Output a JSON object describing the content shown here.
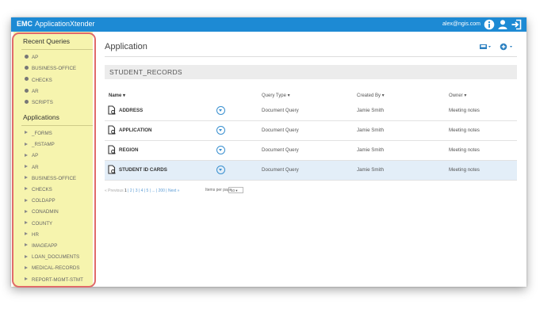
{
  "app": {
    "brand": "EMC",
    "product": "ApplicationXtender",
    "user_email": "alex@ngis.com"
  },
  "sidebar": {
    "recent_title": "Recent Queries",
    "recent": [
      "AP",
      "BUSINESS-OFFICE",
      "CHECKS",
      "AR",
      "SCRIPTS"
    ],
    "apps_title": "Applications",
    "apps": [
      "_FORMS",
      "_RSTAMP",
      "AP",
      "AR",
      "BUSINESS-OFFICE",
      "CHECKS",
      "COLDAPP",
      "CONADMIN",
      "COUNTY",
      "HR",
      "IMAGEAPP",
      "LOAN_DOCUMENTS",
      "MEDICAL-RECORDS",
      "REPORT-MGMT-STMT"
    ]
  },
  "main": {
    "title": "Application",
    "group": "STUDENT_RECORDS",
    "columns": {
      "name": "Name ▾",
      "type": "Query Type ▾",
      "created": "Created By ▾",
      "owner": "Owner ▾"
    },
    "rows": [
      {
        "name": "ADDRESS",
        "type": "Document Query",
        "created": "Jamie Smith",
        "owner": "Meeting notes"
      },
      {
        "name": "APPLICATION",
        "type": "Document Query",
        "created": "Jamie Smith",
        "owner": "Meeting notes"
      },
      {
        "name": "REGION",
        "type": "Document Query",
        "created": "Jamie Smith",
        "owner": "Meeting notes"
      },
      {
        "name": "STUDENT ID CARDS",
        "type": "Document Query",
        "created": "Jamie Smith",
        "owner": "Meeting notes"
      }
    ],
    "pager": {
      "prev": "« Previous",
      "pages": [
        "1",
        "2",
        "3",
        "4",
        "5",
        "...",
        "200"
      ],
      "next": "Next »",
      "items_label": "Items per page",
      "items_value": "10"
    }
  },
  "colors": {
    "topbar": "#1d8ad4",
    "sidebar": "#f6f4ae",
    "highlight_border": "#e06a6a",
    "selected_row": "#e3eef8",
    "accent": "#2a7fc0"
  },
  "icons": {
    "info": "info-icon",
    "user": "user-icon",
    "logout": "logout-icon",
    "inbox": "inbox-icon",
    "add": "add-circle-icon",
    "document": "document-query-icon",
    "expand": "chevron-down-circle-icon"
  }
}
